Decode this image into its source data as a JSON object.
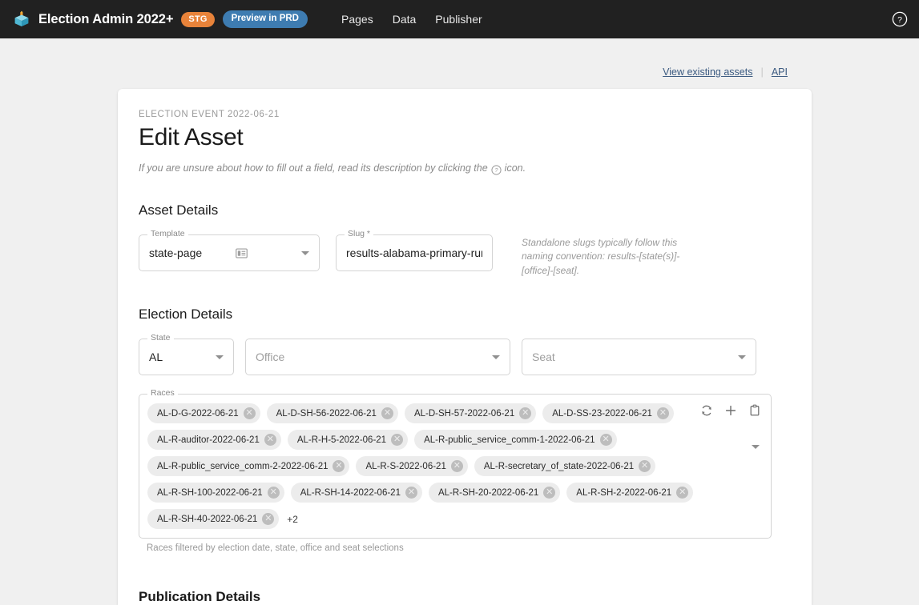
{
  "topbar": {
    "logo_icon": "cube-logo-icon",
    "brand_title": "Election Admin 2022+",
    "badge_stg": "STG",
    "badge_preview": "Preview in PRD",
    "nav": [
      {
        "label": "Pages",
        "name": "nav-pages"
      },
      {
        "label": "Data",
        "name": "nav-data"
      },
      {
        "label": "Publisher",
        "name": "nav-publisher"
      }
    ],
    "help_icon": "help-circle-icon",
    "bg_color": "#212121",
    "stg_color": "#e8833a",
    "preview_color": "#3e7cb1"
  },
  "quicklinks": {
    "view_existing_assets": "View existing assets",
    "separator": "|",
    "api": "API",
    "link_color": "#3b5a80"
  },
  "card": {
    "eyebrow": "ELECTION EVENT 2022-06-21",
    "title": "Edit Asset",
    "subtitle_before": "If you are unsure about how to fill out a field, read its description by clicking the",
    "subtitle_icon": "help-circle-icon",
    "subtitle_after": "icon."
  },
  "asset_details": {
    "section_title": "Asset Details",
    "template": {
      "label": "Template",
      "value": "state-page",
      "icon": "template-list-icon",
      "caret": "chevron-down-icon"
    },
    "slug": {
      "label": "Slug *",
      "value": "results-alabama-primary-runoff"
    },
    "slug_hint": "Standalone slugs typically follow this naming convention: results-[state(s)]-[office]-[seat]."
  },
  "election_details": {
    "section_title": "Election Details",
    "state": {
      "label": "State",
      "value": "AL",
      "caret": "chevron-down-icon"
    },
    "office": {
      "placeholder": "Office",
      "value": "",
      "caret": "chevron-down-icon"
    },
    "seat": {
      "placeholder": "Seat",
      "value": "",
      "caret": "chevron-down-icon"
    },
    "races": {
      "label": "Races",
      "chips": [
        "AL-D-G-2022-06-21",
        "AL-D-SH-56-2022-06-21",
        "AL-D-SH-57-2022-06-21",
        "AL-D-SS-23-2022-06-21",
        "AL-R-auditor-2022-06-21",
        "AL-R-H-5-2022-06-21",
        "AL-R-public_service_comm-1-2022-06-21",
        "AL-R-public_service_comm-2-2022-06-21",
        "AL-R-S-2022-06-21",
        "AL-R-secretary_of_state-2022-06-21",
        "AL-R-SH-100-2022-06-21",
        "AL-R-SH-14-2022-06-21",
        "AL-R-SH-20-2022-06-21",
        "AL-R-SH-2-2022-06-21",
        "AL-R-SH-40-2022-06-21"
      ],
      "overflow": "+2",
      "remove_glyph": "✕",
      "actions": [
        {
          "name": "refresh-icon",
          "title": "refresh"
        },
        {
          "name": "plus-icon",
          "title": "add"
        },
        {
          "name": "clipboard-icon",
          "title": "copy"
        }
      ],
      "caret": "chevron-down-icon",
      "hint": "Races filtered by election date, state, office and seat selections"
    }
  },
  "publication_details": {
    "section_title": "Publication Details"
  }
}
